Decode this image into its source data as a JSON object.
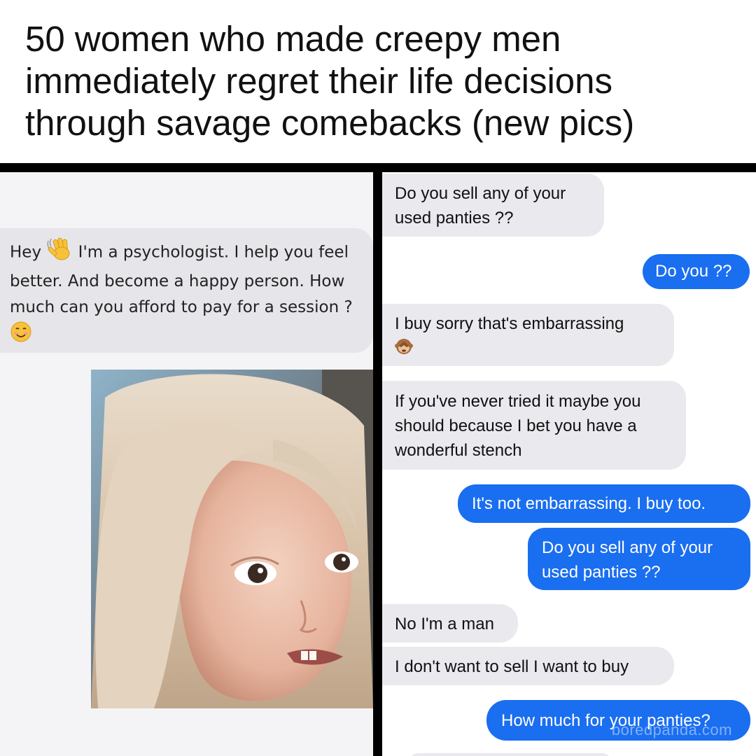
{
  "title": "50 women who made creepy men immediately regret their life decisions through savage comebacks (new pics)",
  "left_panel": {
    "message_before": "Hey",
    "message_after": " I'm a psychologist. I help you feel better. And become a happy person. How much can you afford to pay for a session ?",
    "emoji_1": "waving-hand-emoji",
    "emoji_2": "smiling-face-emoji"
  },
  "right_panel": {
    "messages": [
      {
        "side": "received",
        "text": "Do you sell any of your used panties ??"
      },
      {
        "side": "sent",
        "text": "Do you ??"
      },
      {
        "side": "received",
        "text": "I buy sorry that's embarrassing"
      },
      {
        "side": "received",
        "text": "If you've never tried it maybe you should because I bet you have a wonderful stench"
      },
      {
        "side": "sent",
        "text": "It's not embarrassing. I buy too."
      },
      {
        "side": "sent",
        "text": "Do you sell any of your used panties ??"
      },
      {
        "side": "received",
        "text": "No I'm a man"
      },
      {
        "side": "received",
        "text": "I don't want to sell I want to buy"
      },
      {
        "side": "sent",
        "text": "How much for your panties?"
      }
    ]
  },
  "watermark": "boredpanda.com",
  "colors": {
    "sent_bubble": "#1a6ef0",
    "received_bubble": "#e9e9ee",
    "divider": "#000000"
  }
}
